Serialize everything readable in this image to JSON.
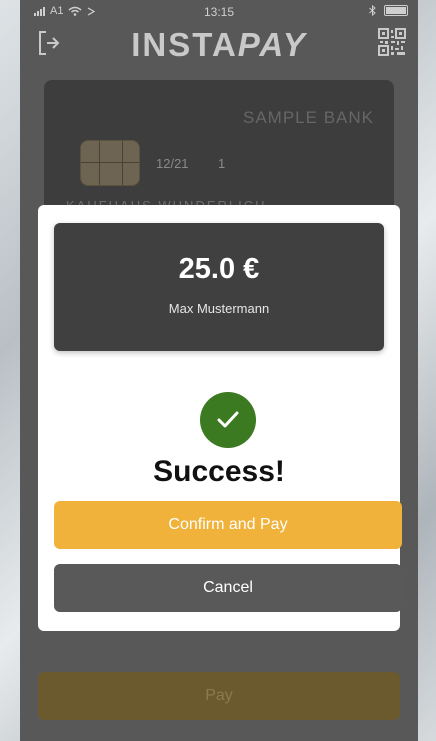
{
  "status_bar": {
    "carrier": "A1",
    "time": "13:15"
  },
  "header": {
    "title_part1": "INSTA",
    "title_part2": "PAY"
  },
  "card": {
    "bank_name": "SAMPLE BANK",
    "expiry": "12/21",
    "sequence": "1",
    "holder": "KAUFHAUS WUNDERLICH"
  },
  "modal": {
    "amount": "25.0 €",
    "payer_name": "Max Mustermann",
    "status_text": "Success!",
    "confirm_label": "Confirm and Pay",
    "cancel_label": "Cancel"
  },
  "footer": {
    "pay_label": "Pay"
  },
  "colors": {
    "confirm": "#f0b23a",
    "success": "#3c7a22",
    "cancel": "#595959"
  }
}
